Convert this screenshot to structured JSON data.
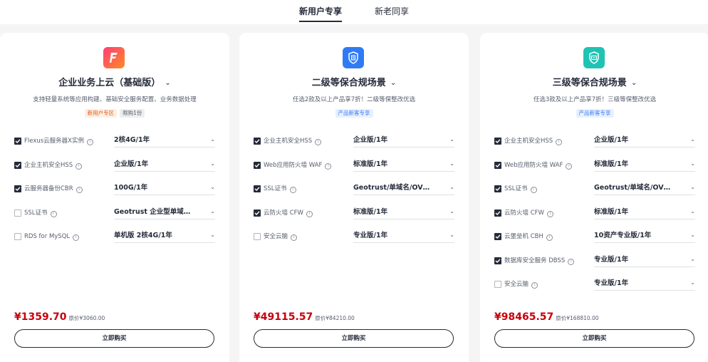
{
  "tabs": [
    {
      "label": "新用户专享",
      "active": true
    },
    {
      "label": "新老同享",
      "active": false
    }
  ],
  "cards": [
    {
      "icon": "lightning-f-icon",
      "title": "企业业务上云（基础版）",
      "description": "支持轻量系统等应用构建、基础安全服务配置、业务数据处理",
      "tags": [
        "新用户专区",
        "限购1份"
      ],
      "items": [
        {
          "label": "Flexus云服务器X实例",
          "checked": true,
          "value": "2核4G/1年"
        },
        {
          "label": "企业主机安全HSS",
          "checked": true,
          "value": "企业版/1年"
        },
        {
          "label": "云服务器备份CBR",
          "checked": true,
          "value": "100G/1年"
        },
        {
          "label": "SSL证书",
          "checked": false,
          "value": "Geotrust 企业型单域…"
        },
        {
          "label": "RDS for MySQL",
          "checked": false,
          "value": "单机版 2核4G/1年"
        }
      ],
      "price": "¥1359.70",
      "original_price": "原价¥3060.00",
      "buy_label": "立即购买"
    },
    {
      "icon": "shield-document-icon",
      "title": "二级等保合规场景",
      "description": "任选2款及以上产品享7折！二级等保整改优选",
      "tags": [
        "产品新客专享"
      ],
      "items": [
        {
          "label": "企业主机安全HSS",
          "checked": true,
          "value": "企业版/1年"
        },
        {
          "label": "Web应用防火墙 WAF",
          "checked": true,
          "value": "标准版/1年"
        },
        {
          "label": "SSL证书",
          "checked": true,
          "value": "Geotrust/单域名/OV…"
        },
        {
          "label": "云防火墙 CFW",
          "checked": true,
          "value": "标准版/1年"
        },
        {
          "label": "安全云脑",
          "checked": false,
          "value": "专业版/1年"
        }
      ],
      "price": "¥49115.57",
      "original_price": "原价¥84210.00",
      "buy_label": "立即购买"
    },
    {
      "icon": "shield-compliance-icon",
      "title": "三级等保合规场景",
      "description": "任选3款及以上产品享7折！三级等保整改优选",
      "tags": [
        "产品新客专享"
      ],
      "items": [
        {
          "label": "企业主机安全HSS",
          "checked": true,
          "value": "企业版/1年"
        },
        {
          "label": "Web应用防火墙 WAF",
          "checked": true,
          "value": "标准版/1年"
        },
        {
          "label": "SSL证书",
          "checked": true,
          "value": "Geotrust/单域名/OV…"
        },
        {
          "label": "云防火墙 CFW",
          "checked": true,
          "value": "标准版/1年"
        },
        {
          "label": "云堡垒机 CBH",
          "checked": true,
          "value": "10资产专业版/1年"
        },
        {
          "label": "数据库安全服务 DBSS",
          "checked": true,
          "value": "专业版/1年"
        },
        {
          "label": "安全云脑",
          "checked": false,
          "value": "专业版/1年"
        }
      ],
      "price": "¥98465.57",
      "original_price": "原价¥168810.00",
      "buy_label": "立即购买"
    }
  ],
  "colors": {
    "price": "#c7000b",
    "icon_card1": "#ff5a3c",
    "icon_card2": "#2f7bf5",
    "icon_card3": "#1fc3b3"
  }
}
